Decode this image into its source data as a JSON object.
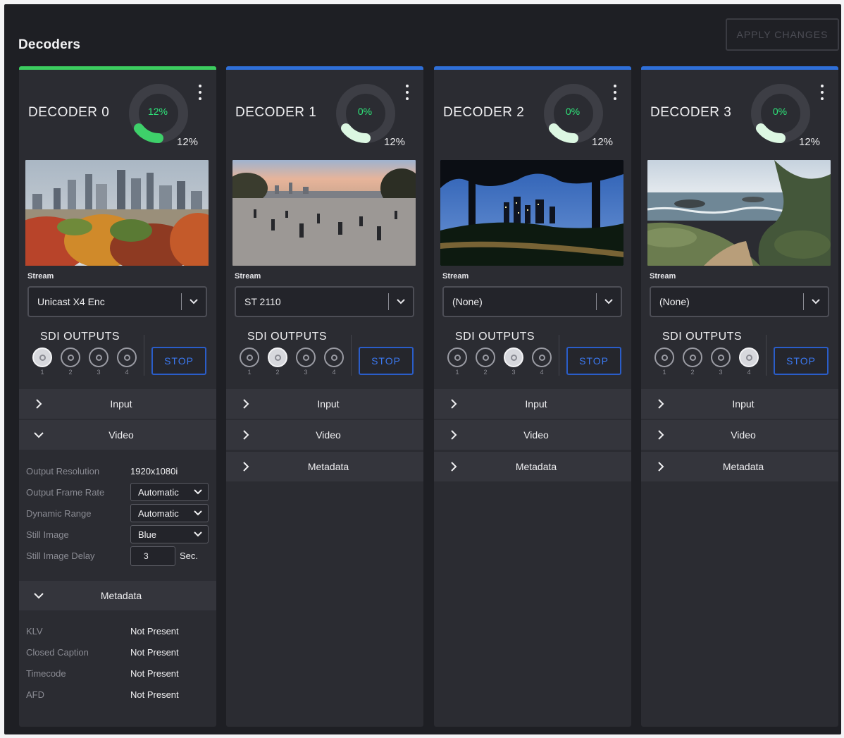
{
  "page": {
    "title": "Decoders",
    "apply_label": "APPLY CHANGES"
  },
  "labels": {
    "stream": "Stream",
    "sdi_outputs": "SDI OUTPUTS",
    "stop": "STOP",
    "input": "Input",
    "video": "Video",
    "metadata": "Metadata",
    "sdi_numbers": [
      "1",
      "2",
      "3",
      "4"
    ]
  },
  "colors": {
    "active_bar": "#3ccc5f",
    "idle_bar": "#2f6fd8",
    "gauge_green": "#2ee67a",
    "gauge_light": "#d8f7df",
    "stop_blue": "#3b78f0"
  },
  "decoders": [
    {
      "name": "DECODER 0",
      "gauge_pct": "12%",
      "gauge_fraction": 0.12,
      "gauge_sub": "12%",
      "stream": "Unicast X4 Enc",
      "active_sdi": 1,
      "status": "active",
      "thumbnail": "city-autumn-skyline"
    },
    {
      "name": "DECODER 1",
      "gauge_pct": "0%",
      "gauge_fraction": 0.0,
      "gauge_sub": "12%",
      "stream": "ST 2110",
      "active_sdi": 2,
      "status": "idle",
      "thumbnail": "plaza-crowd-sunset"
    },
    {
      "name": "DECODER 2",
      "gauge_pct": "0%",
      "gauge_fraction": 0.0,
      "gauge_sub": "12%",
      "stream": "(None)",
      "active_sdi": 3,
      "status": "idle",
      "thumbnail": "night-city-trees"
    },
    {
      "name": "DECODER 3",
      "gauge_pct": "0%",
      "gauge_fraction": 0.0,
      "gauge_sub": "12%",
      "stream": "(None)",
      "active_sdi": 4,
      "status": "idle",
      "thumbnail": "coast-cliff-ocean"
    }
  ],
  "video": {
    "output_resolution_label": "Output Resolution",
    "output_resolution_value": "1920x1080i",
    "frame_rate_label": "Output Frame Rate",
    "frame_rate_value": "Automatic",
    "dynamic_range_label": "Dynamic Range",
    "dynamic_range_value": "Automatic",
    "still_image_label": "Still Image",
    "still_image_value": "Blue",
    "still_delay_label": "Still Image Delay",
    "still_delay_value": "3",
    "still_delay_unit": "Sec."
  },
  "metadata": {
    "klv_label": "KLV",
    "klv_value": "Not Present",
    "cc_label": "Closed Caption",
    "cc_value": "Not Present",
    "tc_label": "Timecode",
    "tc_value": "Not Present",
    "afd_label": "AFD",
    "afd_value": "Not Present"
  }
}
